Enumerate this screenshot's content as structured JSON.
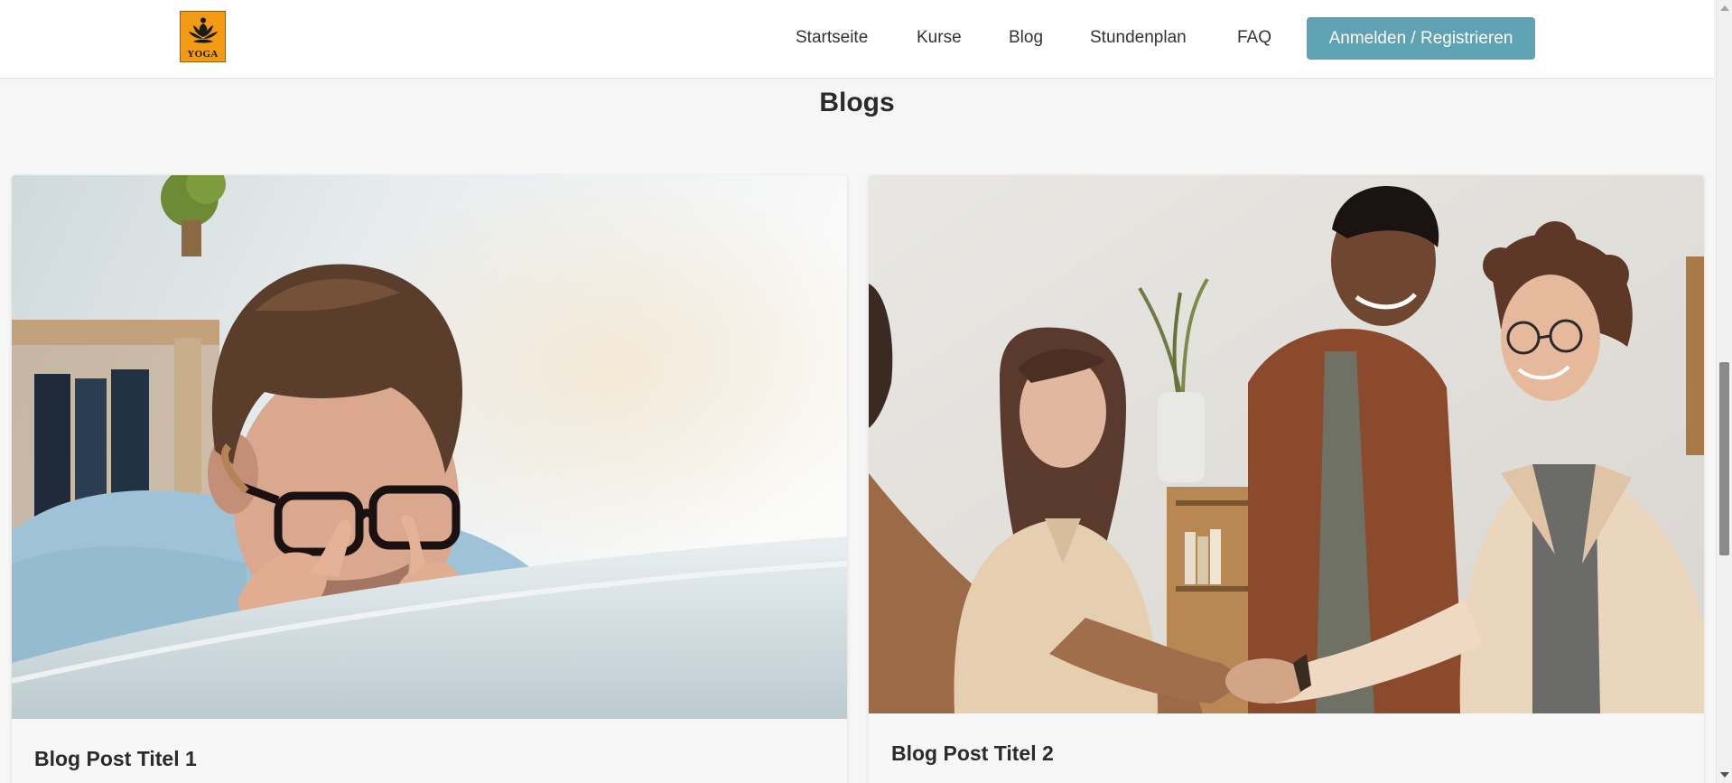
{
  "header": {
    "logo_text": "YOGA",
    "nav": {
      "startseite": "Startseite",
      "kurse": "Kurse",
      "blog": "Blog",
      "stundenplan": "Stundenplan",
      "faq": "FAQ"
    },
    "login_label": "Anmelden / Registrieren"
  },
  "main": {
    "section_title": "Blogs",
    "posts": [
      {
        "title": "Blog Post Titel 1",
        "image": "tired-man-with-glasses-photo"
      },
      {
        "title": "Blog Post Titel 2",
        "image": "team-handshake-photo"
      }
    ]
  },
  "colors": {
    "accent": "#5fa2b4",
    "logo_bg": "#f29a14",
    "page_bg": "#f6f6f6"
  },
  "scrollbar": {
    "position": 0.62
  }
}
